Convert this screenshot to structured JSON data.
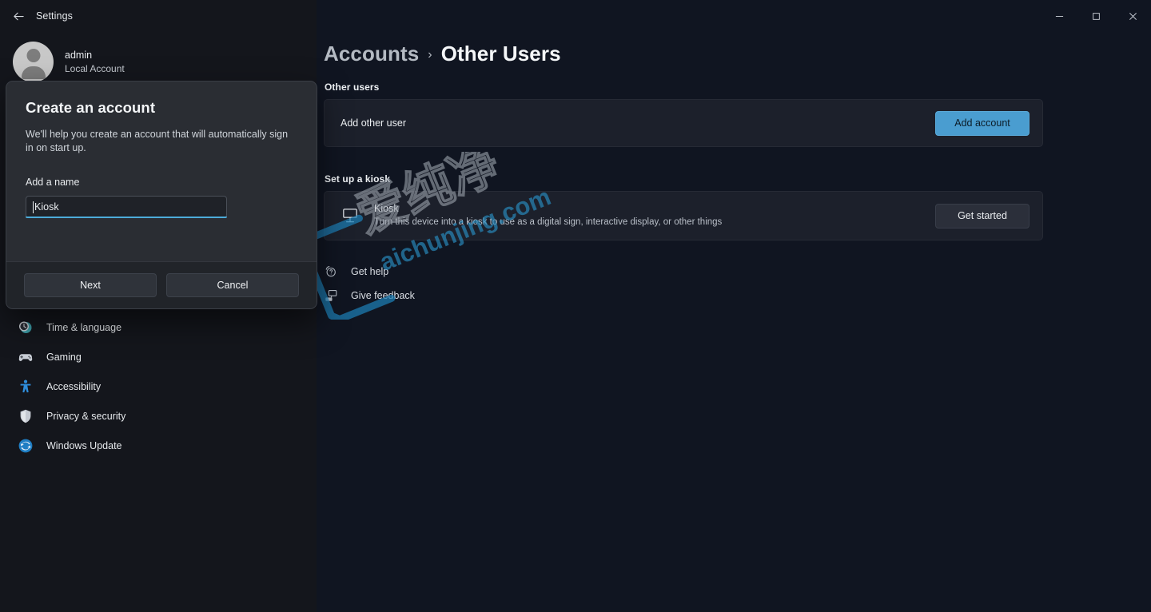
{
  "window": {
    "title": "Settings",
    "back_icon": "back-arrow-icon",
    "minimize_label": "Minimize",
    "maximize_label": "Maximize",
    "close_label": "Close"
  },
  "account": {
    "name": "admin",
    "type": "Local Account"
  },
  "sidebar": {
    "items": [
      {
        "label": "Time & language",
        "icon": "clock-icon"
      },
      {
        "label": "Gaming",
        "icon": "gamepad-icon"
      },
      {
        "label": "Accessibility",
        "icon": "accessibility-icon"
      },
      {
        "label": "Privacy & security",
        "icon": "shield-icon"
      },
      {
        "label": "Windows Update",
        "icon": "update-icon"
      }
    ]
  },
  "main": {
    "breadcrumb": {
      "parent": "Accounts",
      "separator": "›",
      "current": "Other Users"
    },
    "other_users": {
      "section_label": "Other users",
      "row_label": "Add other user",
      "button_label": "Add account"
    },
    "kiosk": {
      "section_label": "Set up a kiosk",
      "icon": "kiosk-display-icon",
      "title": "Kiosk",
      "description": "Turn this device into a kiosk to use as a digital sign, interactive display, or other things",
      "button_label": "Get started"
    },
    "links": [
      {
        "label": "Get help",
        "icon": "help-icon"
      },
      {
        "label": "Give feedback",
        "icon": "feedback-icon"
      }
    ]
  },
  "dialog": {
    "title": "Create an account",
    "description": "We'll help you create an account that will automatically sign in on start up.",
    "field_label": "Add a name",
    "input_value": "Kiosk",
    "input_placeholder": "",
    "primary_button": "Next",
    "secondary_button": "Cancel"
  },
  "watermark": {
    "text_cn": "爱纯净",
    "text_en": "aichunjing.com"
  },
  "colors": {
    "accent": "#4a9dd0",
    "field_underline": "#4cabd9",
    "background": "#101521",
    "card": "#1c202b",
    "dialog": "#2a2d33",
    "watermark_blue": "#1a7fb5"
  }
}
